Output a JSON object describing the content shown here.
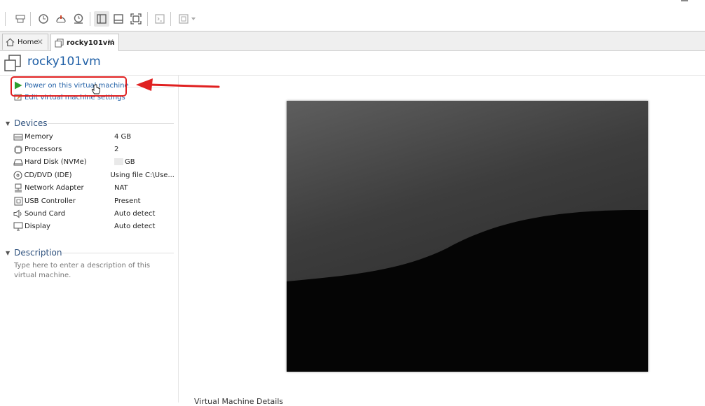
{
  "tabs": [
    {
      "label": "Home",
      "close": "✕"
    },
    {
      "label": "rocky101vm",
      "close": "✕"
    }
  ],
  "vm": {
    "title": "rocky101vm"
  },
  "actions": {
    "power_on": "Power on this virtual machine",
    "edit_settings": "Edit virtual machine settings"
  },
  "devices": {
    "title": "Devices",
    "items": [
      {
        "name": "Memory",
        "value": "4 GB",
        "icon": "memory-icon"
      },
      {
        "name": "Processors",
        "value": "2",
        "icon": "processor-icon"
      },
      {
        "name": "Hard Disk (NVMe)",
        "value": "GB",
        "icon": "hard-disk-icon"
      },
      {
        "name": "CD/DVD (IDE)",
        "value": "Using file C:\\Use...",
        "icon": "cd-dvd-icon"
      },
      {
        "name": "Network Adapter",
        "value": "NAT",
        "icon": "network-adapter-icon"
      },
      {
        "name": "USB Controller",
        "value": "Present",
        "icon": "usb-controller-icon"
      },
      {
        "name": "Sound Card",
        "value": "Auto detect",
        "icon": "sound-card-icon"
      },
      {
        "name": "Display",
        "value": "Auto detect",
        "icon": "display-icon"
      }
    ]
  },
  "description": {
    "title": "Description",
    "placeholder": "Type here to enter a description of this virtual machine."
  },
  "bottom_label": "Virtual Machine Details",
  "colors": {
    "accent": "#1f5fa6",
    "highlight": "#e02020",
    "play": "#2e9e2e"
  }
}
